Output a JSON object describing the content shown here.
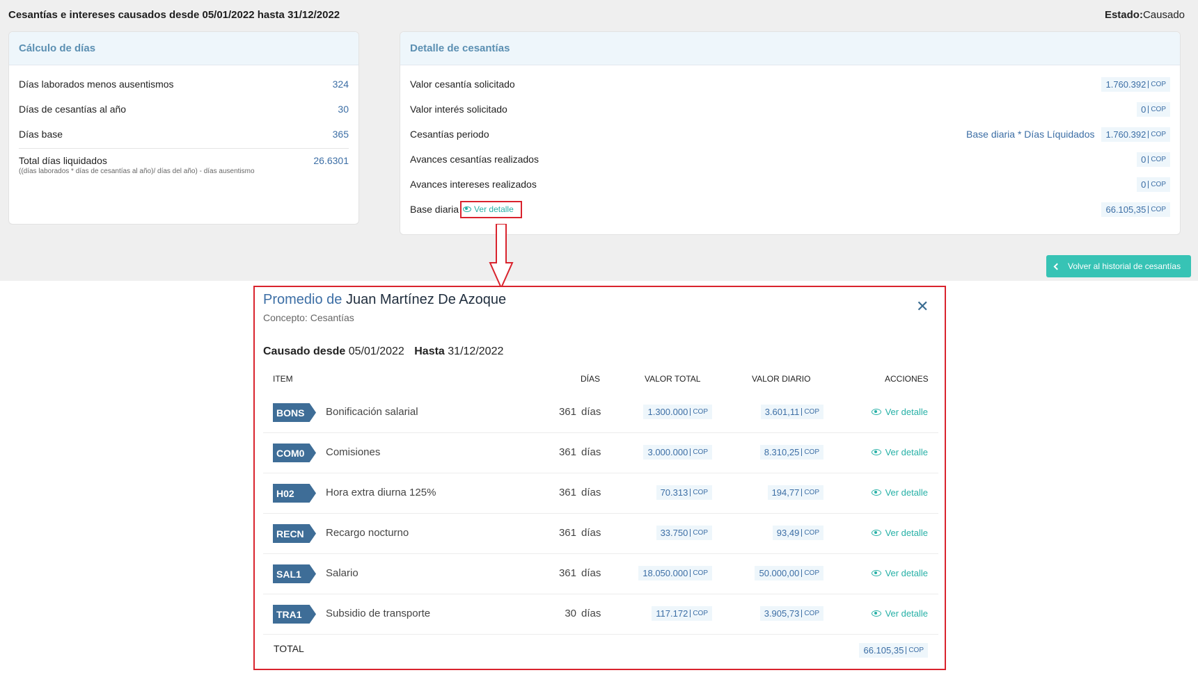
{
  "header": {
    "title": "Cesantías e intereses causados desde 05/01/2022 hasta 31/12/2022",
    "estado_label": "Estado:",
    "estado_value": "Causado"
  },
  "calc_dias": {
    "title": "Cálculo de días",
    "rows": [
      {
        "label": "Días laborados menos ausentismos",
        "value": "324"
      },
      {
        "label": "Días de cesantías al año",
        "value": "30"
      },
      {
        "label": "Días base",
        "value": "365"
      }
    ],
    "total_label": "Total días liquidados",
    "total_formula": "((días laborados * días de cesantías al año)/ días del año) - días ausentismo",
    "total_value": "26.6301"
  },
  "detalle": {
    "title": "Detalle de cesantías",
    "currency": "COP",
    "rows": [
      {
        "label": "Valor cesantía solicitado",
        "value": "1.760.392"
      },
      {
        "label": "Valor interés solicitado",
        "value": "0"
      },
      {
        "label": "Cesantías periodo",
        "formula": "Base diaria * Días Líquidados",
        "value": "1.760.392"
      },
      {
        "label": "Avances cesantías realizados",
        "value": "0"
      },
      {
        "label": "Avances intereses realizados",
        "value": "0"
      },
      {
        "label": "Base diaria",
        "link": "Ver detalle",
        "value": "66.105,35"
      }
    ]
  },
  "back_button": "Volver al historial de cesantías",
  "modal": {
    "title_prefix": "Promedio de",
    "name": "Juan Martínez De Azoque",
    "concept": "Concepto: Cesantías",
    "from_label": "Causado desde",
    "from_value": "05/01/2022",
    "to_label": "Hasta",
    "to_value": "31/12/2022",
    "currency": "COP",
    "columns": [
      "ITEM",
      "DÍAS",
      "VALOR TOTAL",
      "VALOR DIARIO",
      "ACCIONES"
    ],
    "days_unit": "días",
    "action_label": "Ver detalle",
    "rows": [
      {
        "code": "BONS",
        "name": "Bonificación salarial",
        "dias": "361",
        "total": "1.300.000",
        "diario": "3.601,11"
      },
      {
        "code": "COM0",
        "name": "Comisiones",
        "dias": "361",
        "total": "3.000.000",
        "diario": "8.310,25"
      },
      {
        "code": "H02",
        "name": "Hora extra diurna 125%",
        "dias": "361",
        "total": "70.313",
        "diario": "194,77"
      },
      {
        "code": "RECN",
        "name": "Recargo nocturno",
        "dias": "361",
        "total": "33.750",
        "diario": "93,49"
      },
      {
        "code": "SAL1",
        "name": "Salario",
        "dias": "361",
        "total": "18.050.000",
        "diario": "50.000,00"
      },
      {
        "code": "TRA1",
        "name": "Subsidio de transporte",
        "dias": "30",
        "total": "117.172",
        "diario": "3.905,73"
      }
    ],
    "total_label": "TOTAL",
    "total_value": "66.105,35"
  },
  "colors": {
    "accent_teal": "#37c3b5",
    "link_teal": "#26b0a6",
    "blue_value": "#3c6ea5",
    "tag_blue": "#3e6d97",
    "highlight_red": "#d9232d"
  }
}
